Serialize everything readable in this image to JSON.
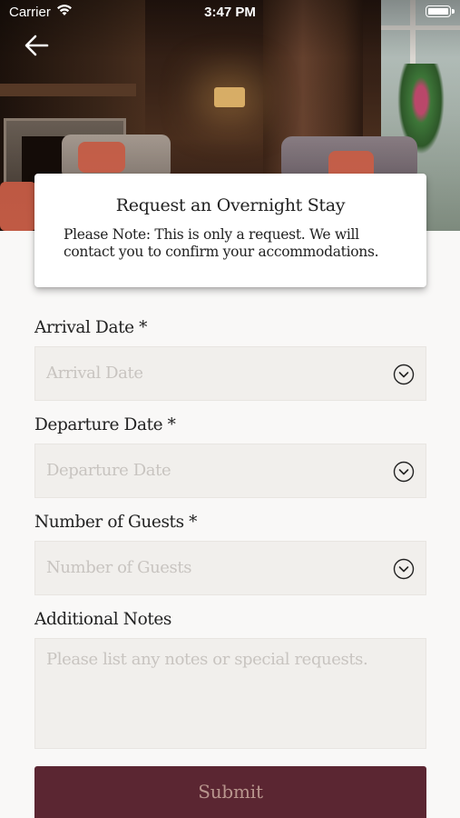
{
  "status_bar": {
    "carrier": "Carrier",
    "time": "3:47 PM"
  },
  "header": {
    "back_icon": "arrow-left-icon",
    "hero_image": "hotel-lounge-photo"
  },
  "info_card": {
    "title": "Request an Overnight Stay",
    "note": "Please Note: This is only a request. We will contact you to confirm your accommodations."
  },
  "form": {
    "arrival": {
      "label": "Arrival Date *",
      "placeholder": "Arrival Date",
      "icon": "chevron-down-circle-icon"
    },
    "departure": {
      "label": "Departure Date *",
      "placeholder": "Departure Date",
      "icon": "chevron-down-circle-icon"
    },
    "guests": {
      "label": "Number of Guests *",
      "placeholder": "Number of Guests",
      "icon": "chevron-down-circle-icon"
    },
    "notes": {
      "label": "Additional Notes",
      "placeholder": "Please list any notes or special requests."
    },
    "submit_label": "Submit"
  },
  "colors": {
    "accent": "#5b2632",
    "submit_text": "#b8958d",
    "field_bg": "#f1efec",
    "page_bg": "#f9f8f7"
  }
}
